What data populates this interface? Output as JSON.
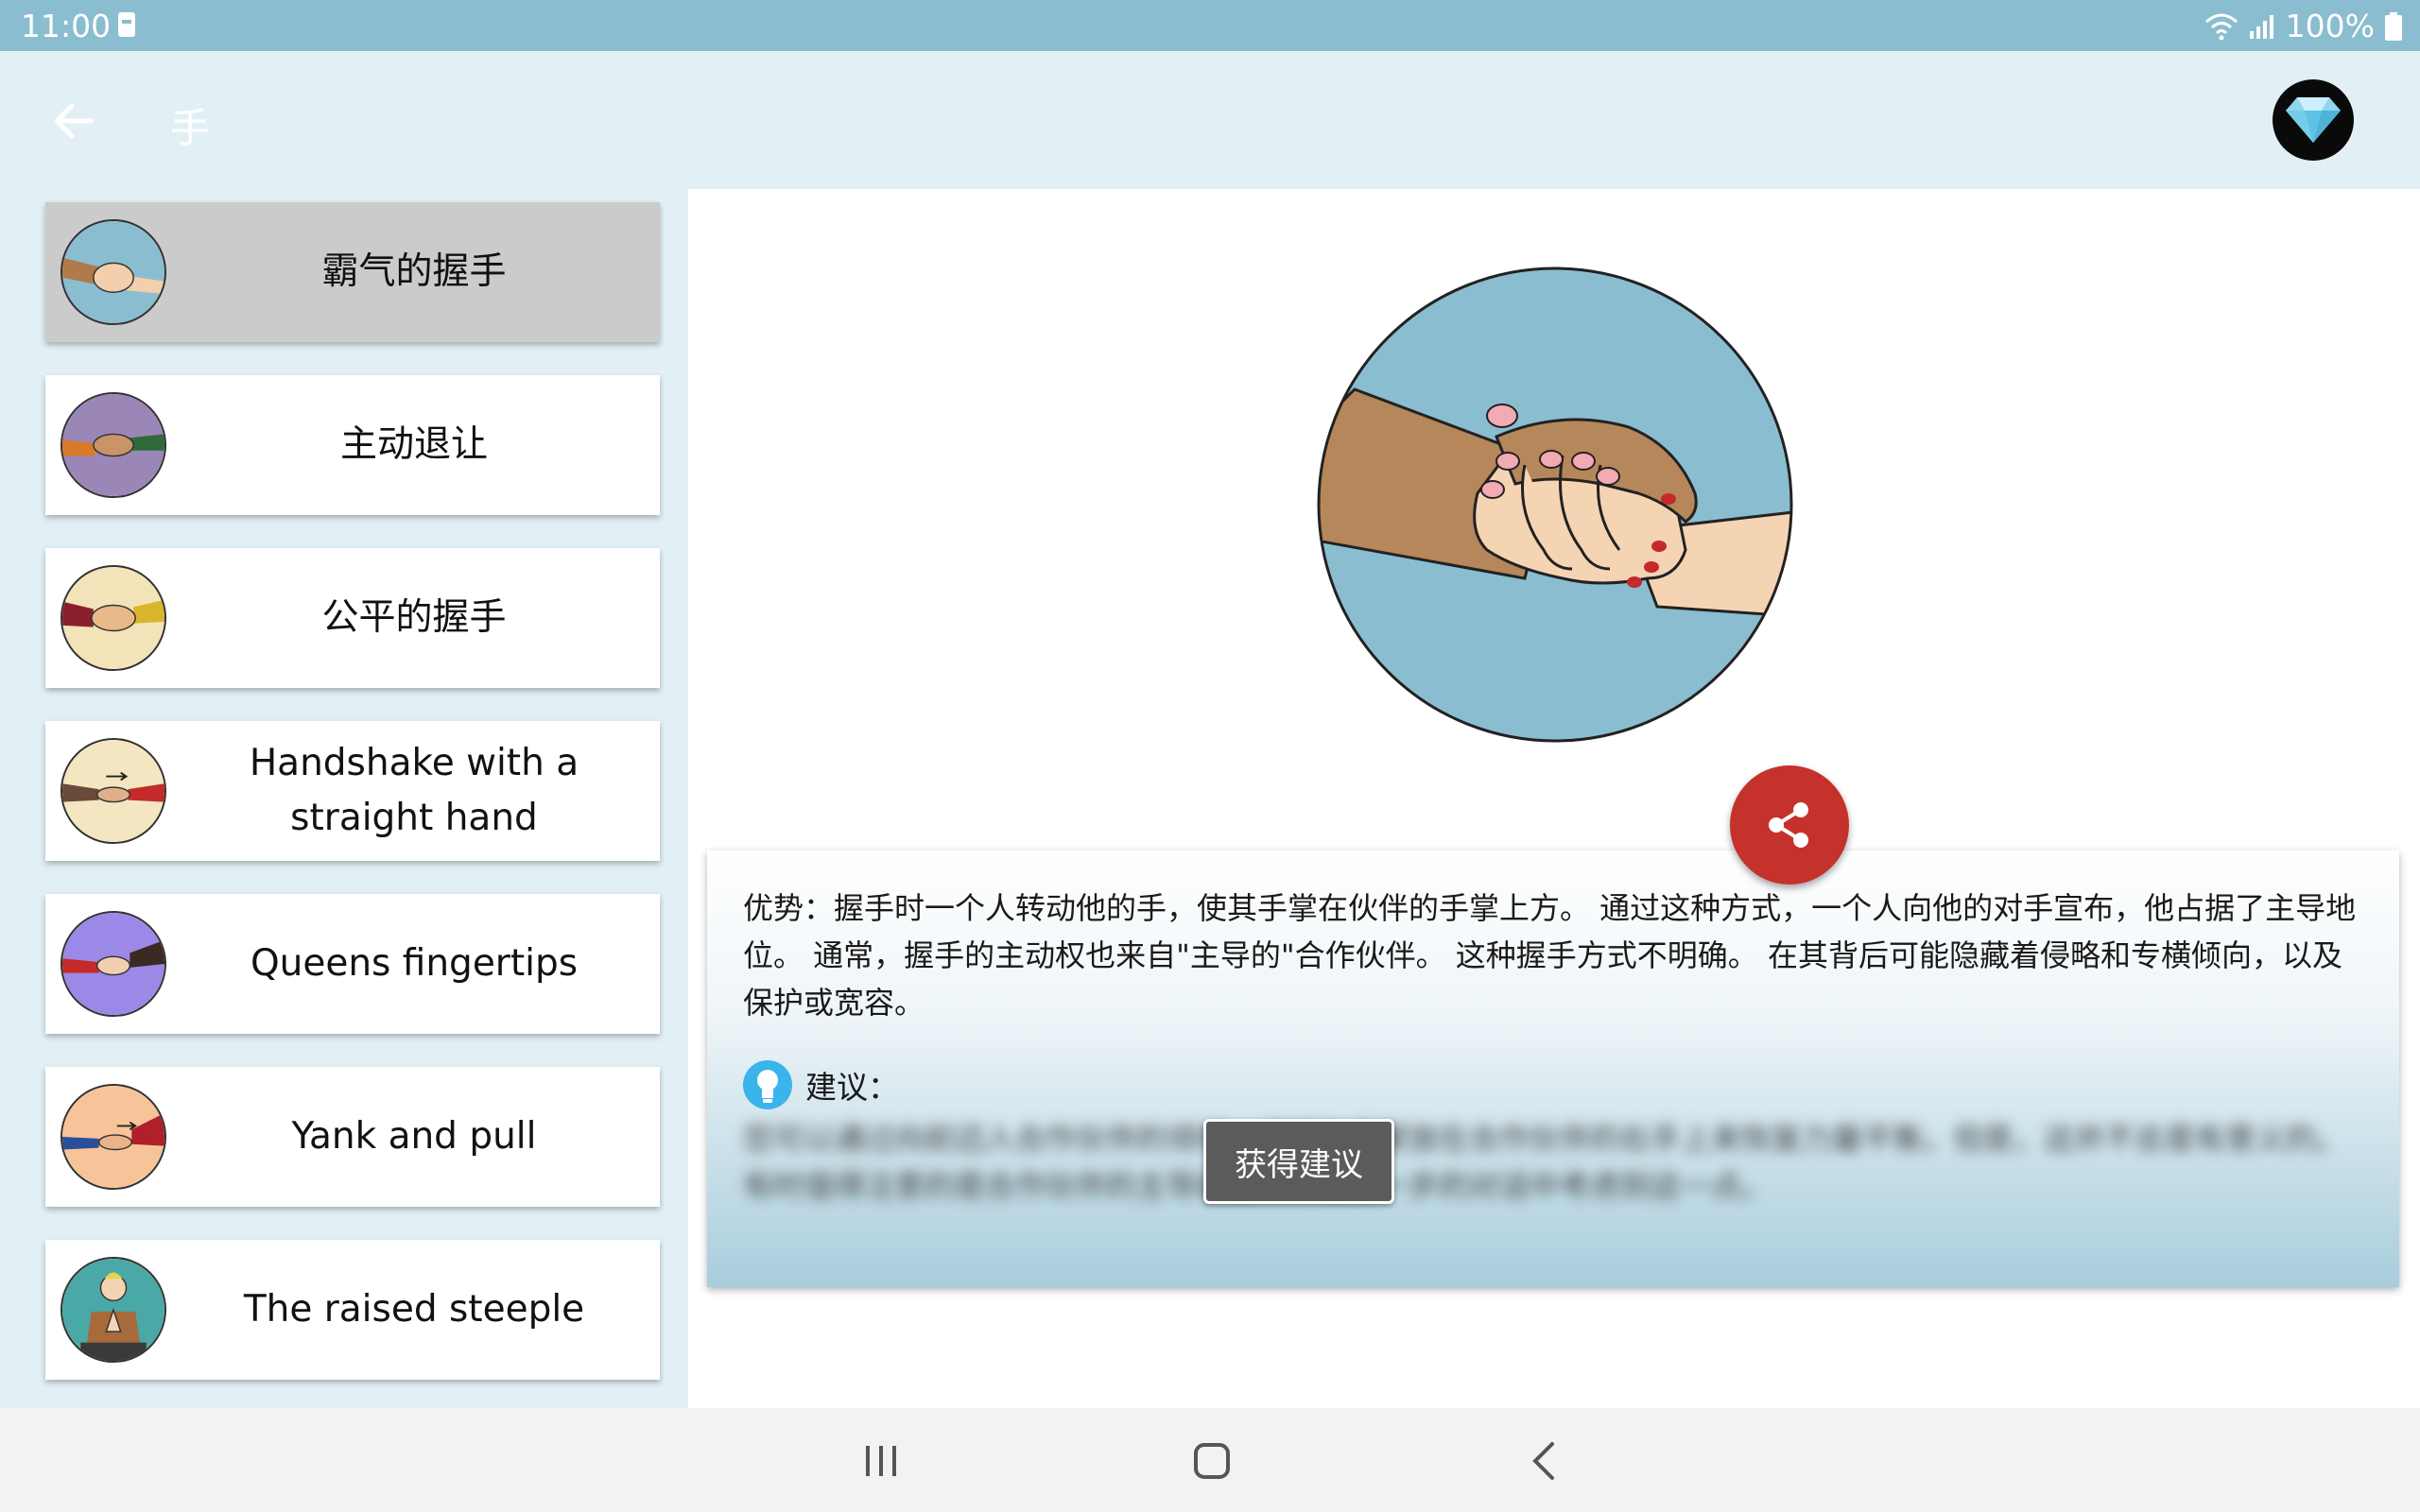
{
  "status_bar": {
    "time": "11:00",
    "battery": "100%"
  },
  "app_bar": {
    "title": "手",
    "back_icon": "arrow-left-icon",
    "premium_icon": "diamond-icon"
  },
  "sidebar": {
    "items": [
      {
        "label": "霸气的握手",
        "selected": true,
        "thumb_color": "#8bbdd0"
      },
      {
        "label": "主动退让",
        "selected": false,
        "thumb_color": "#9b86b8"
      },
      {
        "label": "公平的握手",
        "selected": false,
        "thumb_color": "#f3e3b8"
      },
      {
        "label": "Handshake with a straight hand",
        "selected": false,
        "thumb_color": "#f3e6c0"
      },
      {
        "label": "Queens fingertips",
        "selected": false,
        "thumb_color": "#9c88e6"
      },
      {
        "label": "Yank and pull",
        "selected": false,
        "thumb_color": "#f7c49a"
      },
      {
        "label": "The raised steeple",
        "selected": false,
        "thumb_color": "#4aa8a6"
      }
    ]
  },
  "detail": {
    "description": "优势：握手时一个人转动他的手，使其手掌在伙伴的手掌上方。 通过这种方式，一个人向他的对手宣布，他占据了主导地位。 通常，握手的主动权也来自\"主导的\"合作伙伴。 这种握手方式不明确。 在其背后可能隐藏着侵略和专横倾向，以及保护或宽容。",
    "tip_label": "建议：",
    "tip_text_hidden": "您可以通过向前迈入合作伙伴的领域，或将左手掌放在合作伙伴的右手上来恢复力量平衡。但是，这并不总是有意义的。有时值得注意的是合作伙伴的主导欲望，并在进一步的对话中考虑到这一点。",
    "get_tip_button": "获得建议",
    "share_icon": "share-icon",
    "tip_icon": "lightbulb-icon"
  },
  "nav_bar": {
    "recents_icon": "recents-icon",
    "home_icon": "home-icon",
    "back_icon": "back-chevron-icon"
  },
  "colors": {
    "status_bar": "#8bbdd0",
    "app_bar": "#e2f0f5",
    "share_button": "#c4322b",
    "tip_icon": "#3ab4ea"
  }
}
